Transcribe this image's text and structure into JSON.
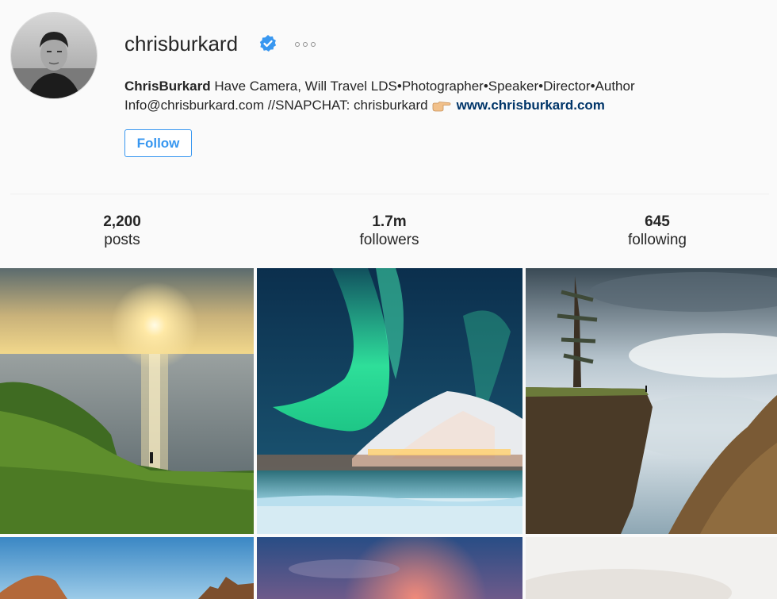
{
  "profile": {
    "username": "chrisburkard",
    "verified_icon": "verified-badge-icon",
    "more_icon": "more-options-icon",
    "avatar_icon": "profile-avatar",
    "bio": {
      "full_name": "ChrisBurkard",
      "line1": " Have Camera, Will Travel LDS•Photographer•Speaker•Director•Author",
      "line2": "Info@chrisburkard.com //SNAPCHAT: chrisburkard",
      "hand_icon": "pointing-hand-emoji",
      "website": "www.chrisburkard.com"
    },
    "follow_label": "Follow"
  },
  "stats": {
    "posts": {
      "value": "2,200",
      "label": "posts"
    },
    "followers": {
      "value": "1.7m",
      "label": "followers"
    },
    "following": {
      "value": "645",
      "label": "following"
    }
  },
  "posts": [
    {
      "name": "post-sunset-cliff"
    },
    {
      "name": "post-aurora-mountain"
    },
    {
      "name": "post-cliff-tree"
    },
    {
      "name": "post-coastal-rocks"
    },
    {
      "name": "post-pink-sky"
    },
    {
      "name": "post-misty"
    }
  ],
  "colors": {
    "accent": "#3897f0",
    "link": "#003569",
    "verified": "#3897f0",
    "background": "#fafafa"
  }
}
